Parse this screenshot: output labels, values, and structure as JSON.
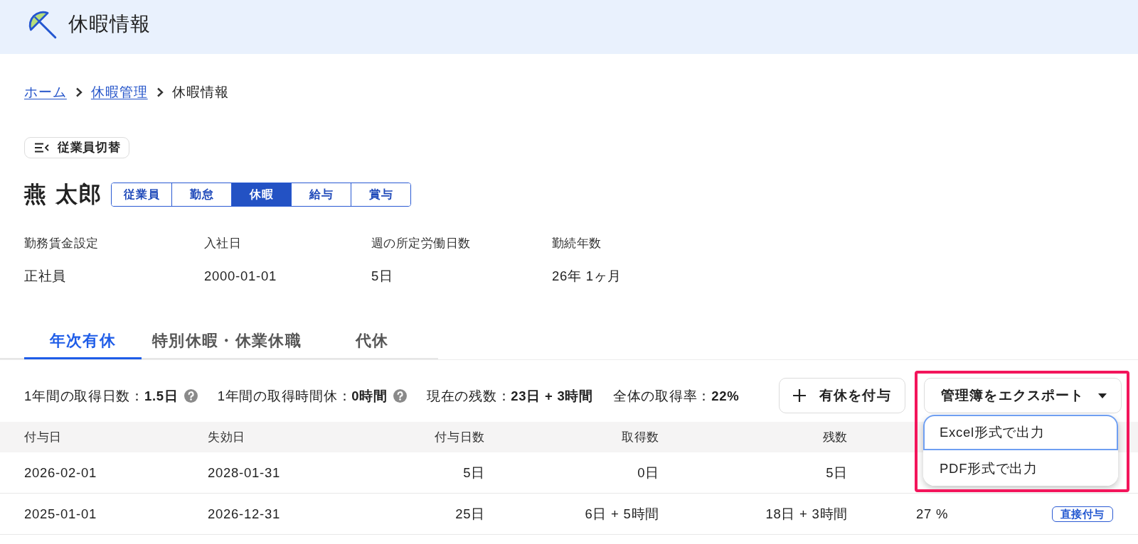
{
  "header": {
    "title": "休暇情報"
  },
  "breadcrumb": [
    {
      "label": "ホーム",
      "kind": "link"
    },
    {
      "label": "休暇管理",
      "kind": "link"
    },
    {
      "label": "休暇情報",
      "kind": "current"
    }
  ],
  "employee_switch": {
    "label": "従業員切替"
  },
  "employee": {
    "name": "燕 太郎"
  },
  "section_tabs": [
    {
      "label": "従業員",
      "selected": false
    },
    {
      "label": "勤怠",
      "selected": false
    },
    {
      "label": "休暇",
      "selected": true
    },
    {
      "label": "給与",
      "selected": false
    },
    {
      "label": "賞与",
      "selected": false
    }
  ],
  "info": [
    {
      "label": "勤務賃金設定",
      "value": "正社員"
    },
    {
      "label": "入社日",
      "value": "2000-01-01"
    },
    {
      "label": "週の所定労働日数",
      "value": "5日"
    },
    {
      "label": "勤続年数",
      "value": "26年 1ヶ月"
    }
  ],
  "leave_tabs": [
    {
      "label": "年次有休",
      "selected": true
    },
    {
      "label": "特別休暇・休業休職",
      "selected": false
    },
    {
      "label": "代休",
      "selected": false
    }
  ],
  "stats": [
    {
      "text": "1年間の取得日数：**1.5日**",
      "help": true
    },
    {
      "text": "1年間の取得時間休：**0時間**",
      "help": true
    },
    {
      "text": "現在の残数：**23日 + 3時間**",
      "help": false
    },
    {
      "text": "全体の取得率：**22%**",
      "help": false
    }
  ],
  "grant_button": {
    "label": "有休を付与"
  },
  "export": {
    "label": "管理簿をエクスポート",
    "expanded": true,
    "highlighted": true,
    "menu": [
      {
        "label": "Excel形式で出力",
        "focused": true
      },
      {
        "label": "PDF形式で出力",
        "focused": false
      }
    ]
  },
  "table": {
    "columns": [
      {
        "label": "付与日",
        "kind": "date"
      },
      {
        "label": "失効日",
        "kind": "date"
      },
      {
        "label": "付与日数",
        "kind": "amount"
      },
      {
        "label": "取得数",
        "kind": "amount"
      },
      {
        "label": "残数",
        "kind": "amount"
      },
      {
        "kind": "rate"
      }
    ],
    "rows": [
      {
        "cells": [
          "2026-02-01",
          "2028-01-31",
          "5日",
          "0日",
          "5日"
        ]
      },
      {
        "cells": [
          "2025-01-01",
          "2026-12-31",
          "25日",
          "6日 + 5時間",
          "18日 + 3時間",
          "27 %"
        ],
        "tag": "直接付与"
      }
    ]
  }
}
